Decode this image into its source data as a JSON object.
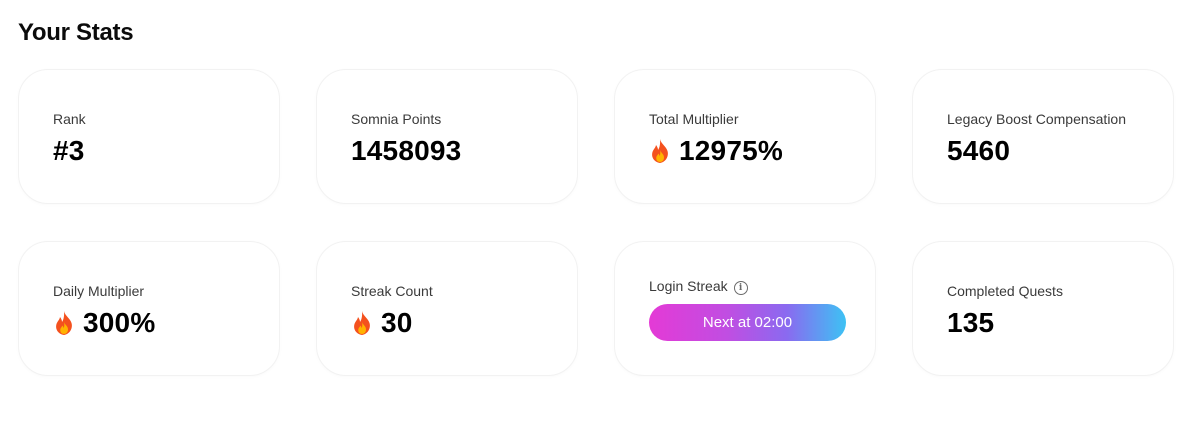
{
  "page": {
    "title": "Your Stats"
  },
  "stats": {
    "rank": {
      "label": "Rank",
      "value": "#3"
    },
    "somnia_points": {
      "label": "Somnia Points",
      "value": "1458093"
    },
    "total_multiplier": {
      "label": "Total Multiplier",
      "value": "12975%",
      "icon": "fire-icon"
    },
    "legacy_boost": {
      "label": "Legacy Boost Compensation",
      "value": "5460"
    },
    "daily_multiplier": {
      "label": "Daily Multiplier",
      "value": "300%",
      "icon": "fire-icon"
    },
    "streak_count": {
      "label": "Streak Count",
      "value": "30",
      "icon": "fire-icon"
    },
    "login_streak": {
      "label": "Login Streak",
      "info_icon": "info-icon",
      "button_label": "Next at 02:00"
    },
    "completed_quests": {
      "label": "Completed Quests",
      "value": "135"
    }
  },
  "colors": {
    "button_gradient_start": "#e43ad6",
    "button_gradient_end": "#3dc2f4",
    "fire_outer": "#f4511e",
    "fire_inner": "#ffb300"
  }
}
